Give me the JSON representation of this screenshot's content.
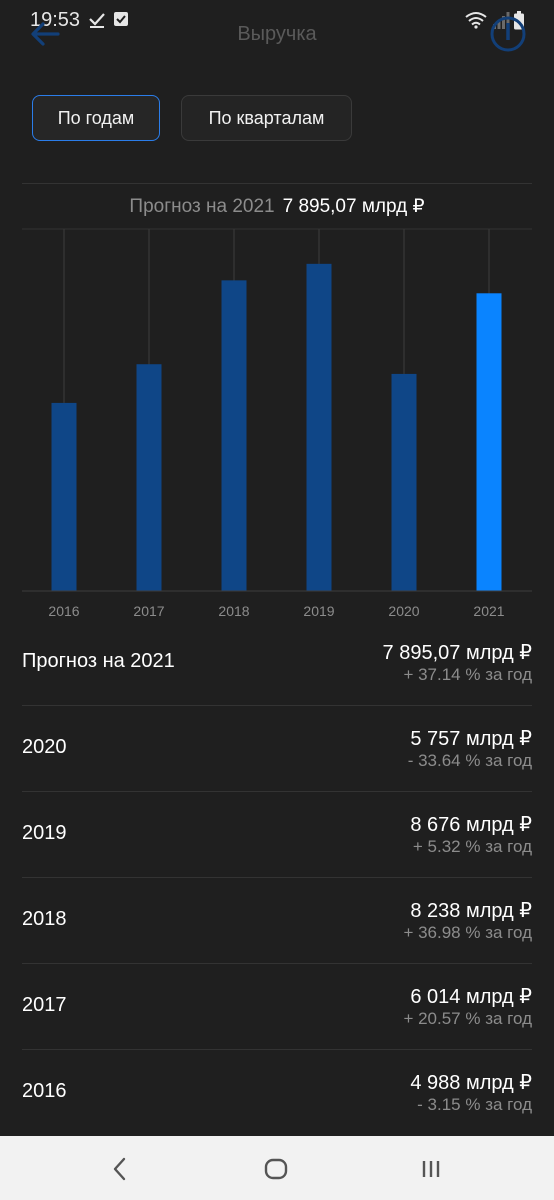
{
  "status": {
    "time": "19:53"
  },
  "header": {
    "title": "Выручка"
  },
  "tabs": [
    {
      "label": "По годам"
    },
    {
      "label": "По кварталам"
    }
  ],
  "forecast": {
    "label": "Прогноз на 2021",
    "value": "7 895,07 млрд ₽"
  },
  "chart_data": {
    "type": "bar",
    "categories": [
      "2016",
      "2017",
      "2018",
      "2019",
      "2020",
      "2021"
    ],
    "values": [
      4988,
      6014,
      8238,
      8676,
      5757,
      7895.07
    ],
    "title": "",
    "xlabel": "",
    "ylabel": "",
    "ylim": [
      0,
      9600
    ],
    "grid": "vertical lines at each category",
    "colors": {
      "bar": "#0f4687",
      "highlight": "#0a84ff",
      "grid": "#3c3c3c",
      "tick": "#8c8c8c"
    },
    "highlight_index": 5
  },
  "rows": [
    {
      "label": "Прогноз на 2021",
      "value": "7 895,07 млрд ₽",
      "change": "+ 37.14 % за год"
    },
    {
      "label": "2020",
      "value": "5 757 млрд ₽",
      "change": "- 33.64 % за год"
    },
    {
      "label": "2019",
      "value": "8 676 млрд ₽",
      "change": "+ 5.32 % за год"
    },
    {
      "label": "2018",
      "value": "8 238 млрд ₽",
      "change": "+ 36.98 % за год"
    },
    {
      "label": "2017",
      "value": "6 014 млрд ₽",
      "change": "+ 20.57 % за год"
    },
    {
      "label": "2016",
      "value": "4 988 млрд ₽",
      "change": "- 3.15 % за год"
    }
  ],
  "icons": {
    "status": [
      "check-icon",
      "checkbox-icon",
      "wifi-icon",
      "signal-icon",
      "battery-icon"
    ],
    "nav": [
      "nav-back-icon",
      "nav-home-icon",
      "nav-recents-icon"
    ]
  }
}
